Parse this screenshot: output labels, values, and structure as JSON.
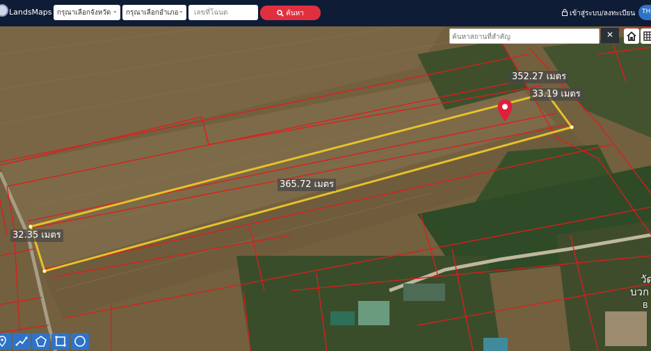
{
  "navbar": {
    "brand": "LandsMaps",
    "province_select": "กรุณาเลือกจังหวัด",
    "district_select": "กรุณาเลือกอำเภอ",
    "deed_placeholder": "เลขที่โฉนด",
    "search_label": "ค้นหา",
    "login_label": "เข้าสู่ระบบ/ลงทะเบียน",
    "lang_label": "TH"
  },
  "map": {
    "place_search_placeholder": "ค้นหาสถานที่สำคัญ",
    "close_label": "✕",
    "measurements": {
      "top": "352.27 เมตร",
      "right": "33.19 เมตร",
      "long": "365.72 เมตร",
      "left": "32.35 เมตร"
    },
    "poi_lines": [
      "วัด",
      "บวก",
      "B"
    ],
    "colors": {
      "plot_outline": "#e6c229",
      "parcel_lines": "#e21b1b",
      "pin": "#e0203a",
      "tool_button": "#2f73c8",
      "navbar": "#0f1c36"
    }
  },
  "toolbar": {
    "tools": [
      "marker-tool-icon",
      "line-tool-icon",
      "polygon-tool-icon",
      "rectangle-tool-icon",
      "circle-tool-icon"
    ]
  }
}
